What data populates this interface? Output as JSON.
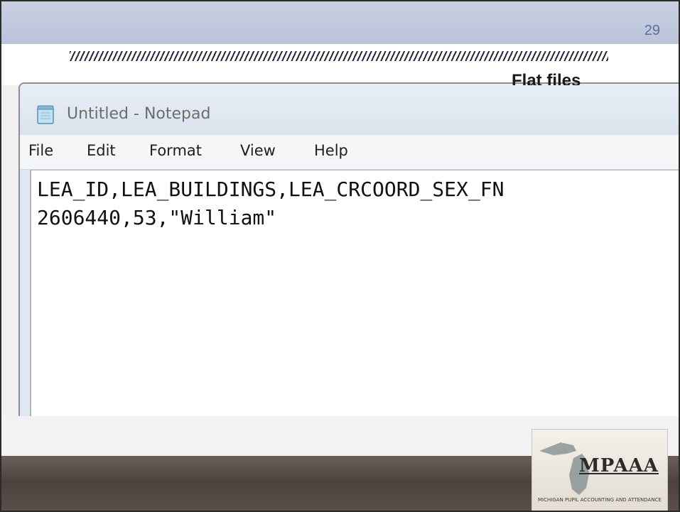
{
  "slide": {
    "number": "29",
    "title": "Flat files"
  },
  "notepad": {
    "window_title": "Untitled - Notepad",
    "icon": "notepad-icon",
    "menu": [
      {
        "label": "File"
      },
      {
        "label": "Edit"
      },
      {
        "label": "Format"
      },
      {
        "label": "View"
      },
      {
        "label": "Help"
      }
    ],
    "content_lines": [
      "LEA_ID,LEA_BUILDINGS,LEA_CRCOORD_SEX_FN",
      "2606440,53,\"William\""
    ]
  },
  "logo": {
    "name": "MPAAA",
    "tagline": "MICHIGAN PUPIL ACCOUNTING AND ATTENDANCE ASSOCIATION"
  },
  "colors": {
    "top_band": "#c2cadd",
    "slide_number": "#5b6e9a",
    "bottom_band": "#5a4f4a"
  }
}
